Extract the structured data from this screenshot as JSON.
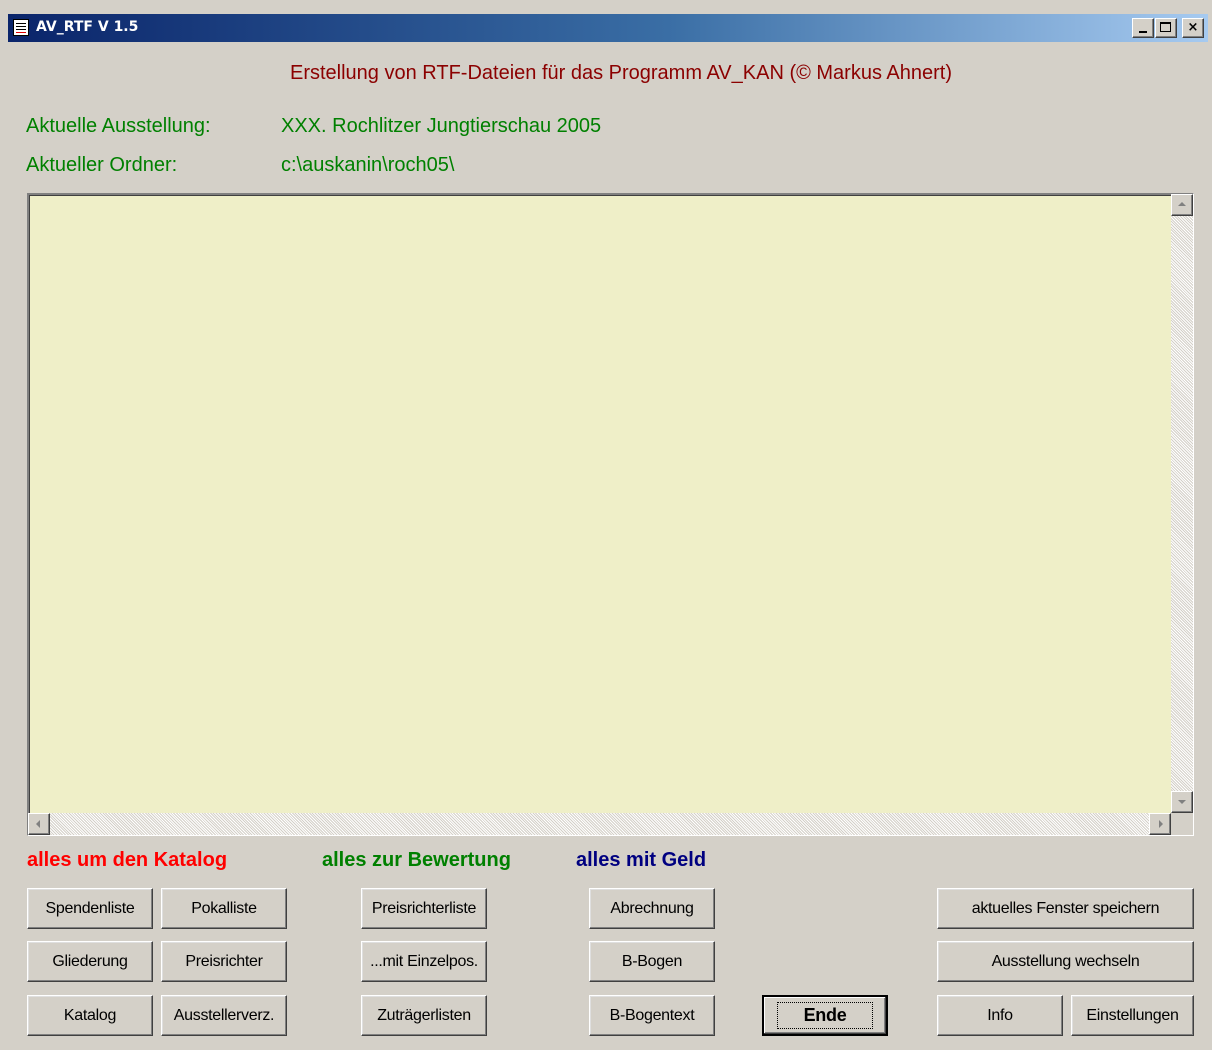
{
  "window": {
    "title": "AV_RTF V 1.5",
    "controls": {
      "minimize": "_",
      "maximize": "□",
      "close": "×"
    }
  },
  "header": {
    "heading": "Erstellung von RTF-Dateien für das Programm AV_KAN (© Markus Ahnert)"
  },
  "info": {
    "exhibition_label": "Aktuelle Ausstellung:",
    "exhibition_value": "XXX. Rochlitzer Jungtierschau 2005",
    "folder_label": "Aktueller Ordner:",
    "folder_value": "c:\\auskanin\\roch05\\"
  },
  "output": {
    "text": ""
  },
  "groups": {
    "catalog": "alles um den Katalog",
    "evaluation": "alles zur Bewertung",
    "money": "alles mit Geld"
  },
  "buttons": {
    "spendenliste": "Spendenliste",
    "pokalliste": "Pokalliste",
    "gliederung": "Gliederung",
    "preisrichter": "Preisrichter",
    "katalog": "Katalog",
    "ausstellerverz": "Ausstellerverz.",
    "preisrichterliste": "Preisrichterliste",
    "mit_einzelpos": "...mit Einzelpos.",
    "zutraegerlisten": "Zuträgerlisten",
    "abrechnung": "Abrechnung",
    "b_bogen": "B-Bogen",
    "b_bogentext": "B-Bogentext",
    "ende": "Ende",
    "fenster_speichern": "aktuelles Fenster speichern",
    "ausstellung_wechseln": "Ausstellung wechseln",
    "info": "Info",
    "einstellungen": "Einstellungen"
  },
  "colors": {
    "heading": "#8b0000",
    "info_text": "#008000",
    "group_catalog": "#ff0000",
    "group_evaluation": "#008000",
    "group_money": "#000080",
    "textarea_bg": "#efefc8",
    "face": "#d4d0c8"
  }
}
